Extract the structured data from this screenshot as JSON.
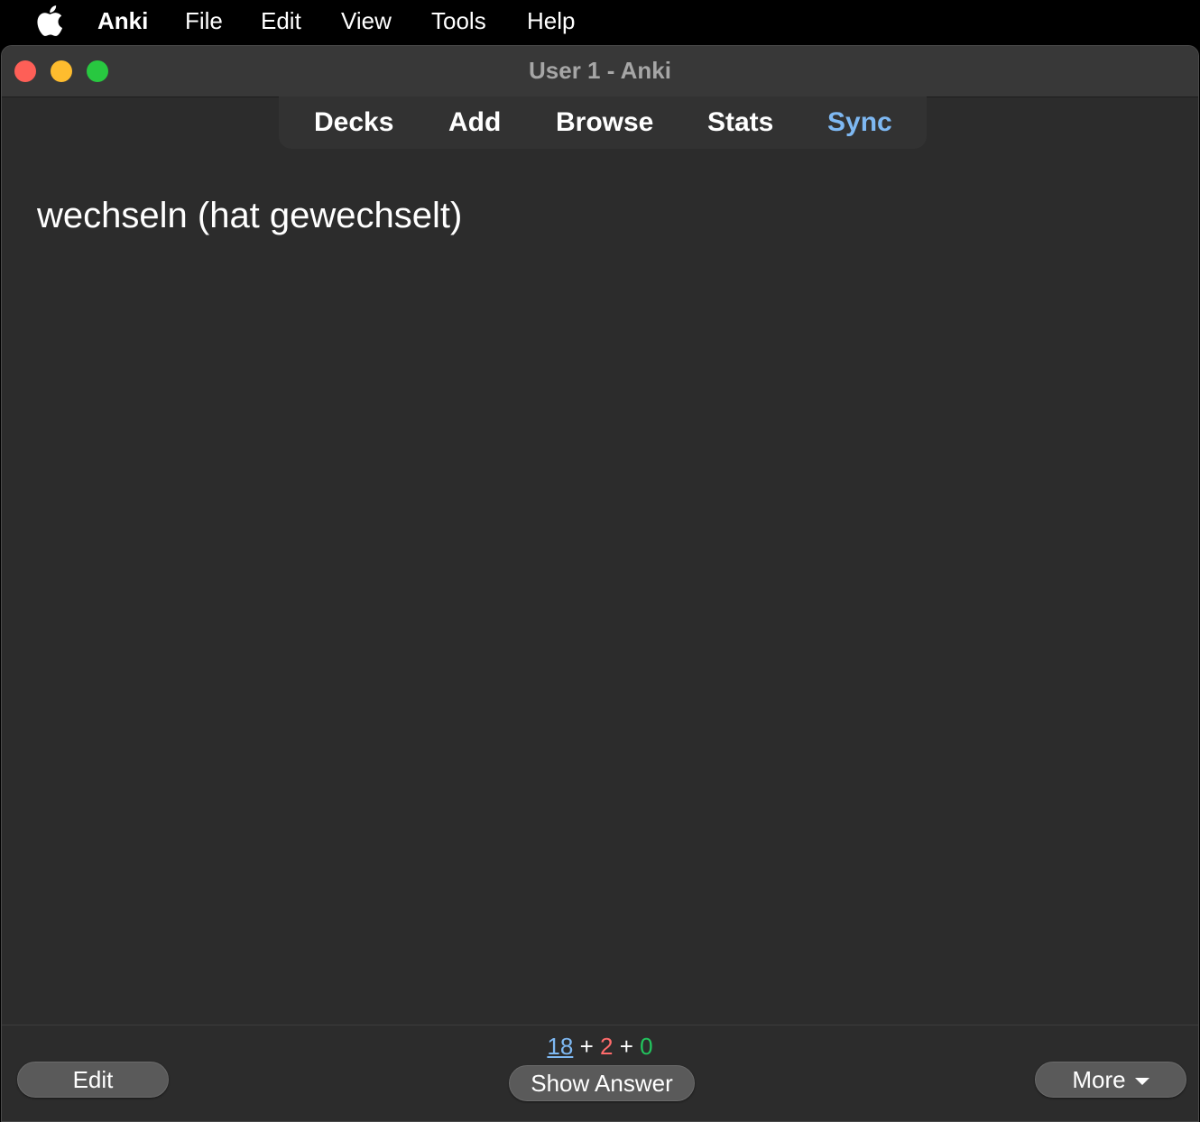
{
  "menubar": {
    "app_name": "Anki",
    "items": [
      "File",
      "Edit",
      "View",
      "Tools",
      "Help"
    ]
  },
  "window": {
    "title": "User 1 - Anki"
  },
  "toolbar": {
    "links": [
      "Decks",
      "Add",
      "Browse",
      "Stats",
      "Sync"
    ],
    "active": "Sync"
  },
  "card": {
    "front_text": "wechseln (hat gewechselt)"
  },
  "bottombar": {
    "counts": {
      "new": "18",
      "learning": "2",
      "review": "0",
      "separator": "+"
    },
    "edit_label": "Edit",
    "show_answer_label": "Show Answer",
    "more_label": "More"
  },
  "colors": {
    "background": "#2c2c2c",
    "accent_blue": "#7eb8f2",
    "learning_red": "#ff6b6b",
    "review_green": "#22c55e"
  }
}
